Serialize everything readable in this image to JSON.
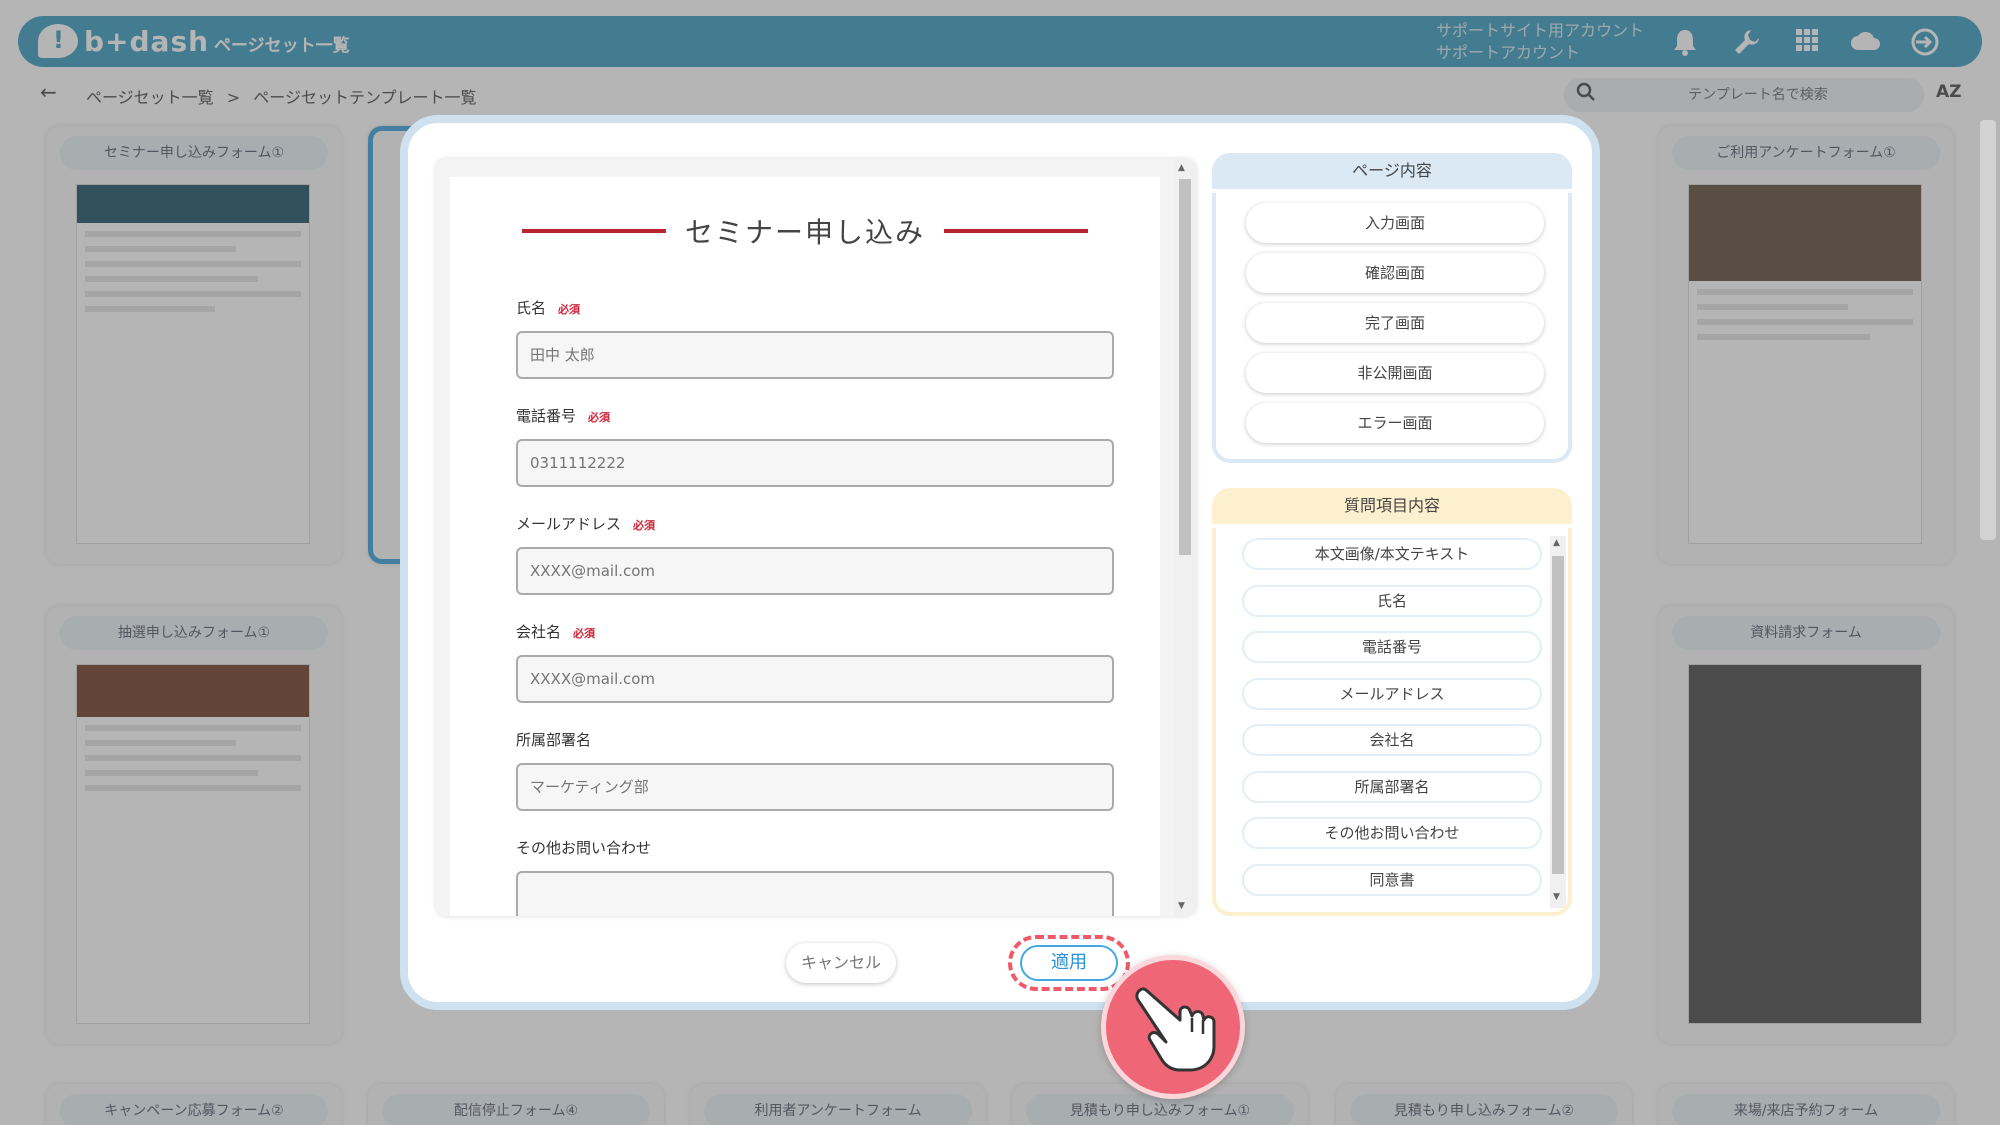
{
  "topbar": {
    "logo_text": "b+dash",
    "title": "ページセット一覧",
    "account_line1": "サポートサイト用アカウント",
    "account_line2": "サポートアカウント",
    "icons": [
      "bell-icon",
      "wrench-icon",
      "grid-icon",
      "cloud-icon",
      "logout-icon"
    ]
  },
  "breadcrumb": {
    "item1": "ページセット一覧",
    "separator": ">",
    "item2": "ページセットテンプレート一覧"
  },
  "search": {
    "placeholder": "テンプレート名で検索"
  },
  "sort_label": "AZ",
  "cards": {
    "row1": [
      "セミナー申し込みフォーム①",
      "ご利用アンケートフォーム①"
    ],
    "row2": [
      "抽選申し込みフォーム①",
      "資料請求フォーム"
    ],
    "row3": [
      "キャンペーン応募フォーム②",
      "配信停止フォーム④",
      "利用者アンケートフォーム",
      "見積もり申し込みフォーム①",
      "見積もり申し込みフォーム②",
      "来場/来店予約フォーム"
    ]
  },
  "modal": {
    "preview": {
      "form_title": "セミナー申し込み",
      "required_label": "必須",
      "fields": [
        {
          "label": "氏名",
          "placeholder": "田中 太郎",
          "required": true
        },
        {
          "label": "電話番号",
          "placeholder": "0311112222",
          "required": true
        },
        {
          "label": "メールアドレス",
          "placeholder": "XXXX@mail.com",
          "required": true
        },
        {
          "label": "会社名",
          "placeholder": "XXXX@mail.com",
          "required": true
        },
        {
          "label": "所属部署名",
          "placeholder": "マーケティング部",
          "required": false
        },
        {
          "label": "その他お問い合わせ",
          "placeholder": "",
          "required": false
        }
      ]
    },
    "page_content": {
      "title": "ページ内容",
      "items": [
        "入力画面",
        "確認画面",
        "完了画面",
        "非公開画面",
        "エラー画面"
      ]
    },
    "question_content": {
      "title": "質問項目内容",
      "items": [
        "本文画像/本文テキスト",
        "氏名",
        "電話番号",
        "メールアドレス",
        "会社名",
        "所属部署名",
        "その他お問い合わせ",
        "同意書"
      ]
    },
    "cancel_label": "キャンセル",
    "apply_label": "適用"
  },
  "colors": {
    "brand": "#47a2c3",
    "accent_red": "#b82530",
    "apply_blue": "#2a92d8",
    "highlight_pink": "#ef6677"
  }
}
